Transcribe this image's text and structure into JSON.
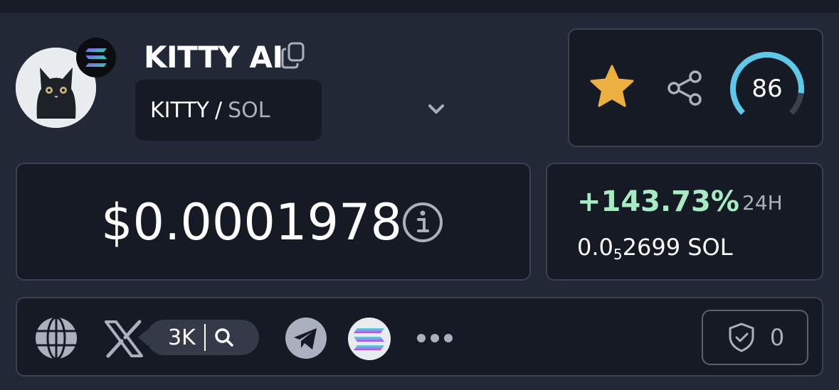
{
  "token": {
    "name": "KITTY AI",
    "pair_base": "KITTY",
    "pair_separator": "/",
    "pair_quote": "SOL"
  },
  "actions": {
    "score": "86",
    "score_fraction": 0.86
  },
  "price": {
    "usd": "$0.0001978"
  },
  "change": {
    "percent": "+143.73%",
    "period": "24H",
    "sol_prefix": "0.0",
    "sol_subscript": "5",
    "sol_suffix": "2699 SOL"
  },
  "links": {
    "x_followers": "3K",
    "audit_count": "0"
  },
  "colors": {
    "background": "#222836",
    "card": "#151a25",
    "border": "#3a4150",
    "positive": "#a7ebc2",
    "star": "#ebb03f",
    "gauge": "#5ec8e8"
  },
  "icons": [
    "copy-icon",
    "chevron-down-icon",
    "star-icon",
    "share-icon",
    "info-icon",
    "globe-icon",
    "x-icon",
    "search-icon",
    "telegram-icon",
    "solana-icon",
    "more-icon",
    "shield-icon"
  ]
}
